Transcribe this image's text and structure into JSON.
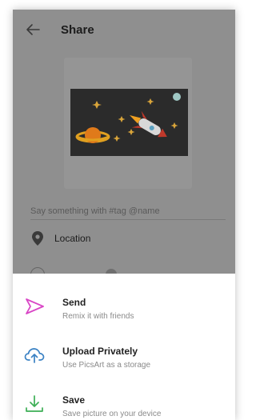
{
  "header": {
    "title": "Share",
    "back_icon": "arrow-left-icon"
  },
  "caption": {
    "placeholder": "Say something with #tag @name"
  },
  "location": {
    "label": "Location",
    "icon": "map-pin-icon"
  },
  "share_options": [
    {
      "label": "Send",
      "subtitle": "Remix it with friends",
      "icon": "send-icon",
      "color": "#d946c6"
    },
    {
      "label": "Upload Privately",
      "subtitle": "Use PicsArt as a storage",
      "icon": "cloud-upload-icon",
      "color": "#3b82c4"
    },
    {
      "label": "Save",
      "subtitle": "Save picture on your device",
      "icon": "download-icon",
      "color": "#3cae55"
    }
  ],
  "colors": {
    "overlay": "#8f8f8f",
    "sheet_background": "#ffffff"
  }
}
